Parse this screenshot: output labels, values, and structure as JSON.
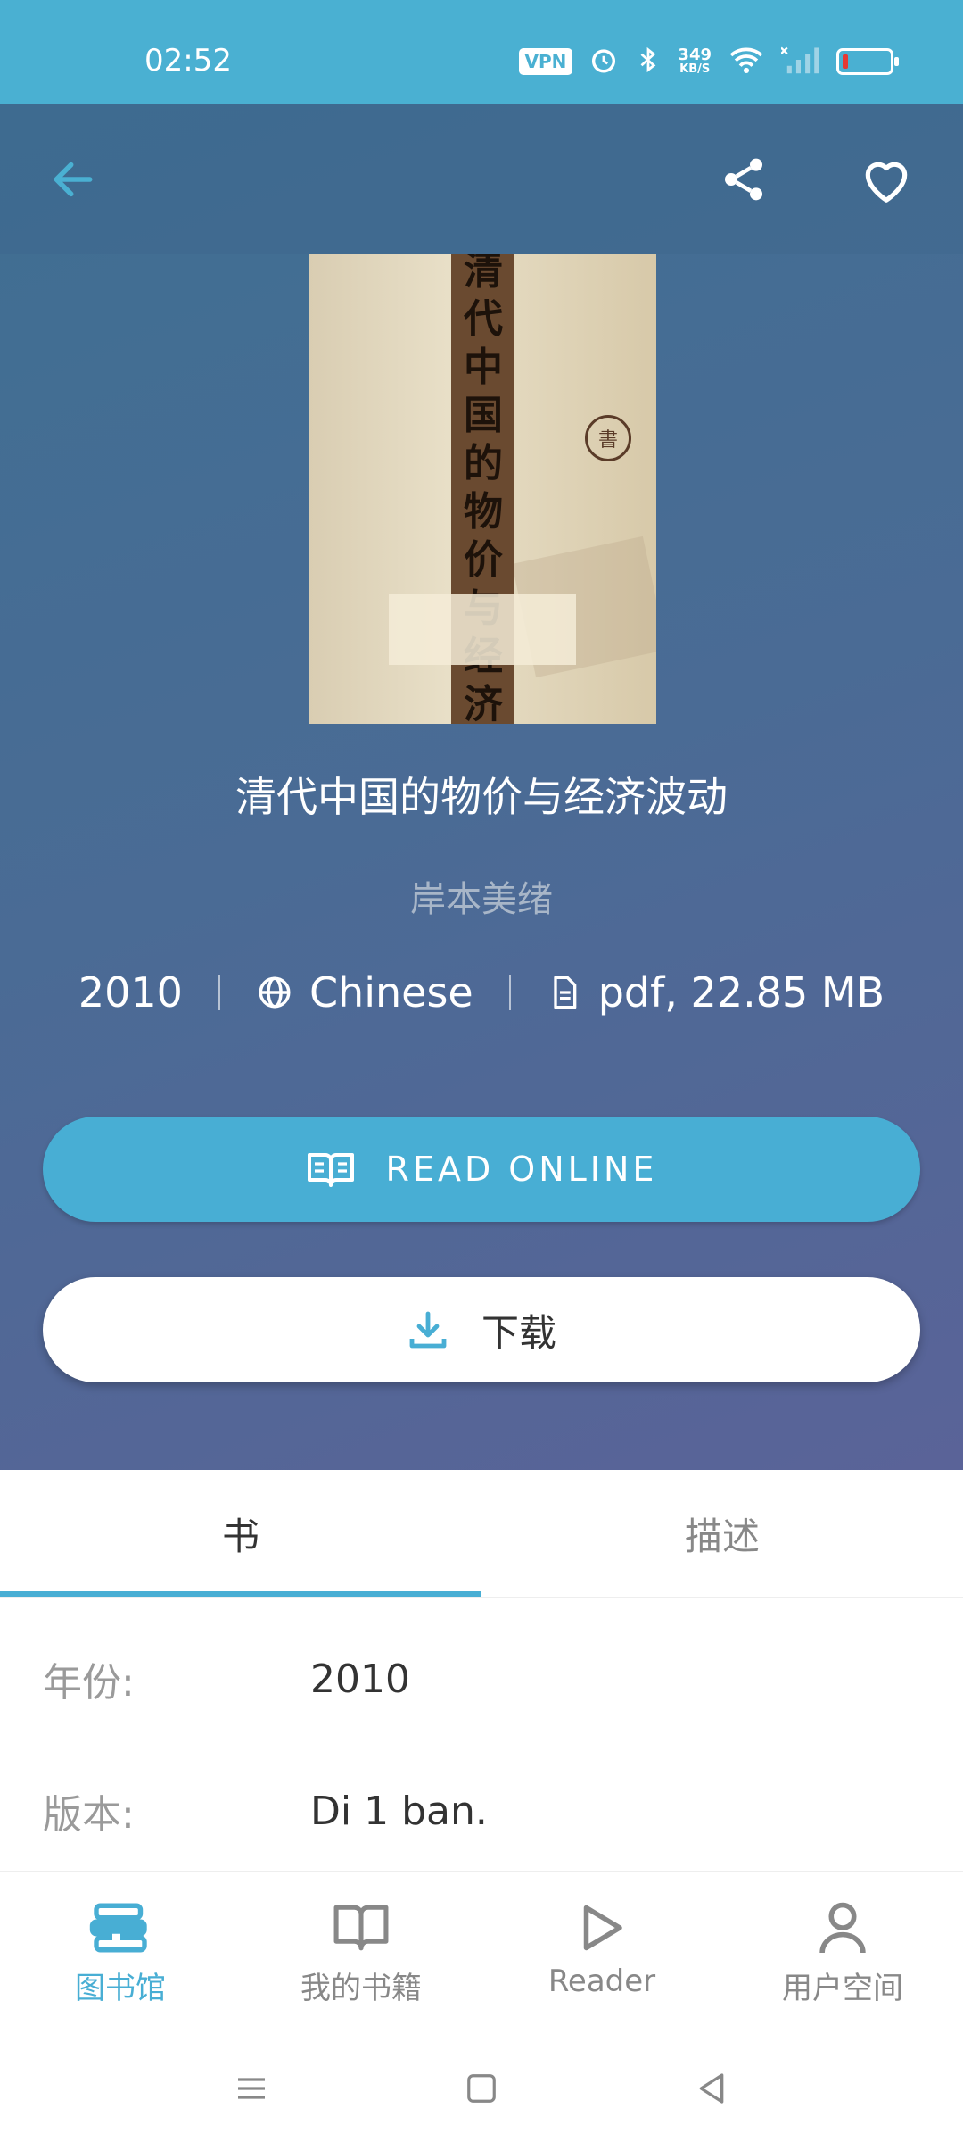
{
  "status_bar": {
    "time": "02:52",
    "vpn": "VPN",
    "speed_value": "349",
    "speed_unit": "KB/S",
    "icons": [
      "alarm-icon",
      "bluetooth-icon",
      "wifi-icon",
      "signal-icon",
      "battery-icon"
    ],
    "battery_level": 0.12,
    "battery_color": "#e53935"
  },
  "toolbar": {
    "icons": [
      "back-arrow-icon",
      "share-icon",
      "heart-icon"
    ]
  },
  "cover": {
    "title_vertical": "清代中国的物价与经济波动",
    "seal_char": "書"
  },
  "book": {
    "title": "清代中国的物价与经济波动",
    "author": "岸本美绪",
    "year": "2010",
    "language": "Chinese",
    "file_info": "pdf, 22.85 MB"
  },
  "actions": {
    "read_online": "READ ONLINE",
    "download": "下载"
  },
  "tabs": [
    {
      "label": "书",
      "active": true
    },
    {
      "label": "描述",
      "active": false
    }
  ],
  "details": [
    {
      "label": "年份:",
      "value": "2010"
    },
    {
      "label": "版本:",
      "value": "Di 1 ban."
    }
  ],
  "bottom_nav": [
    {
      "label": "图书馆",
      "icon": "library-icon",
      "active": true
    },
    {
      "label": "我的书籍",
      "icon": "book-open-icon",
      "active": false
    },
    {
      "label": "Reader",
      "icon": "play-icon",
      "active": false
    },
    {
      "label": "用户空间",
      "icon": "user-icon",
      "active": false
    }
  ],
  "colors": {
    "accent": "#48aed4",
    "status_bar": "#4ab0d2",
    "hero_gradient_start": "#3f6f92",
    "hero_gradient_end": "#5a6398"
  }
}
